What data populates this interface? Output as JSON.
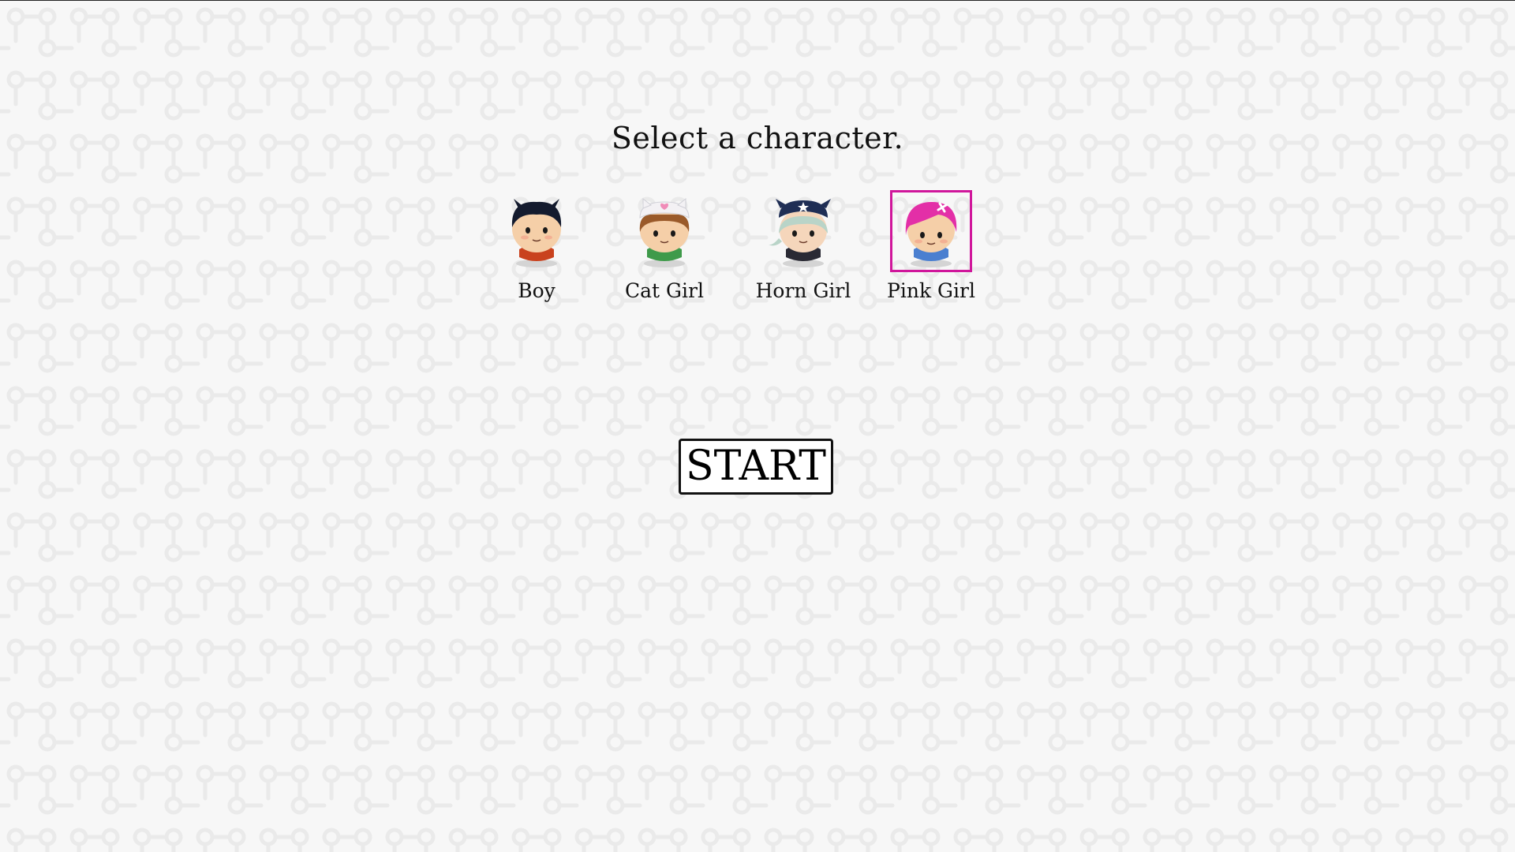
{
  "prompt": "Select a character.",
  "characters": [
    {
      "label": "Boy",
      "hair": "#141b2e",
      "shirt": "#c9421e",
      "accent": "#141b2e",
      "selected": false
    },
    {
      "label": "Cat Girl",
      "hair": "#9a5a2a",
      "shirt": "#3f9a4a",
      "accent": "#f3f1f4",
      "selected": false
    },
    {
      "label": "Horn Girl",
      "hair": "#b9d4c8",
      "shirt": "#2a2a34",
      "accent": "#1f2e55",
      "selected": false
    },
    {
      "label": "Pink Girl",
      "hair": "#e32fa7",
      "shirt": "#4a7fd0",
      "accent": "#ffffff",
      "selected": true
    }
  ],
  "start_label": "START",
  "colors": {
    "selection_border": "#d0169b",
    "background": "#f7f7f7",
    "pattern": "#ececec"
  }
}
